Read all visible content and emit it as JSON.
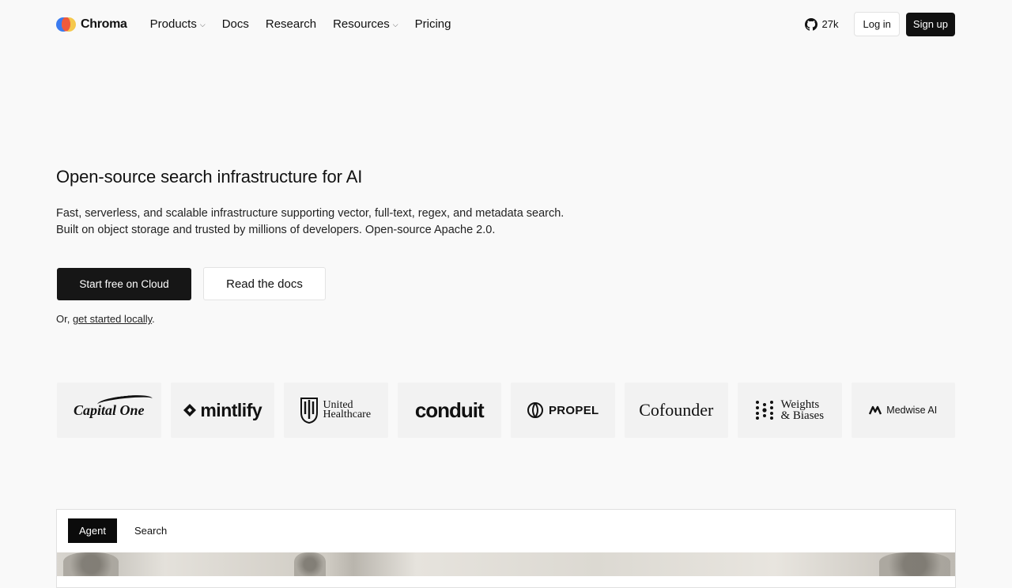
{
  "brand": {
    "name": "Chroma"
  },
  "nav": {
    "items": [
      {
        "label": "Products",
        "has_dropdown": true
      },
      {
        "label": "Docs",
        "has_dropdown": false
      },
      {
        "label": "Research",
        "has_dropdown": false
      },
      {
        "label": "Resources",
        "has_dropdown": true
      },
      {
        "label": "Pricing",
        "has_dropdown": false
      }
    ],
    "github_stars": "27k",
    "login_label": "Log in",
    "signup_label": "Sign up"
  },
  "hero": {
    "title": "Open-source search infrastructure for AI",
    "subtitle": "Fast, serverless, and scalable infrastructure supporting vector, full-text, regex, and metadata search. Built on object storage and trusted by millions of developers. Open-source Apache 2.0.",
    "primary_cta": "Start free on Cloud",
    "secondary_cta": "Read the docs",
    "local_prefix": "Or, ",
    "local_link": "get started locally",
    "local_suffix": "."
  },
  "logos": {
    "capital_one": "Capital One",
    "mintlify": "mintlify",
    "united_line1": "United",
    "united_line2": "Healthcare",
    "conduit": "conduit",
    "propel": "PROPEL",
    "cofounder": "Cofounder",
    "wb_line1": "Weights",
    "wb_line2": "& Biases",
    "medwise": "Medwise AI"
  },
  "demo": {
    "tabs": [
      "Agent",
      "Search"
    ],
    "active_tab": "Agent"
  },
  "colors": {
    "background": "#f9f9f9",
    "primary_button": "#161616",
    "text": "#111111"
  }
}
